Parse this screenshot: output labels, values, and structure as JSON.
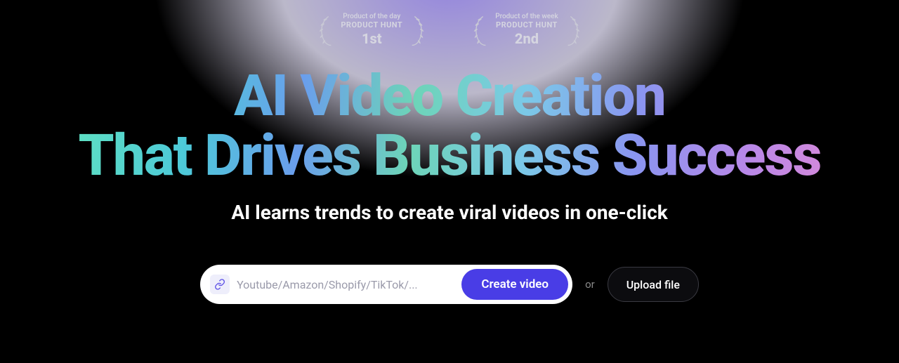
{
  "badges": [
    {
      "subtitle": "Product of the day",
      "title": "PRODUCT HUNT",
      "rank": "1st"
    },
    {
      "subtitle": "Product of the week",
      "title": "PRODUCT HUNT",
      "rank": "2nd"
    }
  ],
  "hero": {
    "title_line1": "AI Video Creation",
    "title_line2": "That Drives Business Success",
    "subtitle": "AI learns trends to create viral videos in one-click"
  },
  "input_bar": {
    "placeholder": "Youtube/Amazon/Shopify/TikTok/...",
    "create_label": "Create video",
    "or_label": "or",
    "upload_label": "Upload file"
  }
}
